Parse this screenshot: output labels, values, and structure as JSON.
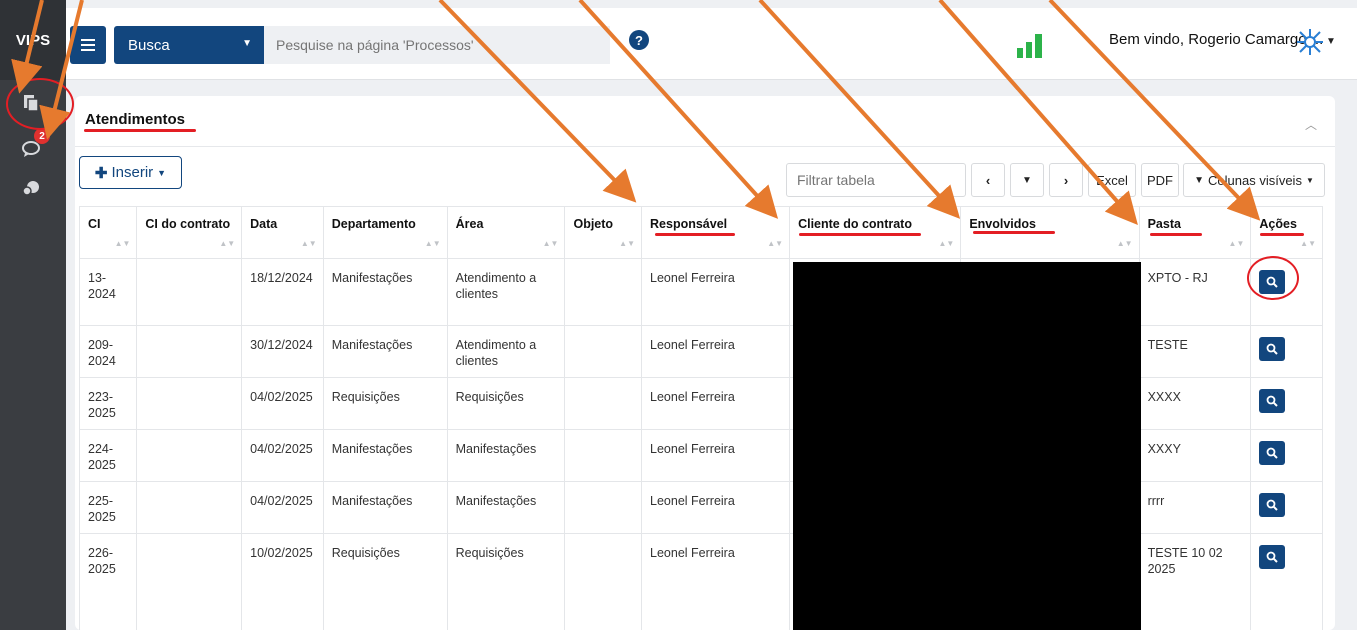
{
  "app": {
    "logo": "VIPS"
  },
  "sidebar": {
    "badge_count": "2",
    "icons": [
      "documents-icon",
      "chat-icon",
      "user-group-icon"
    ]
  },
  "topbar": {
    "search_select": "Busca",
    "search_placeholder": "Pesquise na página 'Processos'",
    "welcome": "Bem vindo, Rogerio Camargo ..."
  },
  "card": {
    "title": "Atendimentos",
    "insert_label": "Inserir",
    "filter_placeholder": "Filtrar tabela",
    "excel_label": "Excel",
    "pdf_label": "PDF",
    "columns_label": "Colunas visíveis"
  },
  "table": {
    "headers": [
      "CI",
      "CI do contrato",
      "Data",
      "Departamento",
      "Área",
      "Objeto",
      "Responsável",
      "Cliente do contrato",
      "Envolvidos",
      "Pasta",
      "Ações"
    ],
    "rows": [
      {
        "ci": "13-2024",
        "ci_contrato": "",
        "data": "18/12/2024",
        "departamento": "Manifestações",
        "area": "Atendimento a clientes",
        "objeto": "",
        "responsavel": "Leonel Ferreira",
        "cliente": "",
        "envolvidos": "",
        "pasta": "XPTO - RJ"
      },
      {
        "ci": "209-2024",
        "ci_contrato": "",
        "data": "30/12/2024",
        "departamento": "Manifestações",
        "area": "Atendimento a clientes",
        "objeto": "",
        "responsavel": "Leonel Ferreira",
        "cliente": "",
        "envolvidos": "",
        "pasta": "TESTE"
      },
      {
        "ci": "223-2025",
        "ci_contrato": "",
        "data": "04/02/2025",
        "departamento": "Requisições",
        "area": "Requisições",
        "objeto": "",
        "responsavel": "Leonel Ferreira",
        "cliente": "",
        "envolvidos": "",
        "pasta": "XXXX"
      },
      {
        "ci": "224-2025",
        "ci_contrato": "",
        "data": "04/02/2025",
        "departamento": "Manifestações",
        "area": "Manifestações",
        "objeto": "",
        "responsavel": "Leonel Ferreira",
        "cliente": "",
        "envolvidos": "",
        "pasta": "XXXY"
      },
      {
        "ci": "225-2025",
        "ci_contrato": "",
        "data": "04/02/2025",
        "departamento": "Manifestações",
        "area": "Manifestações",
        "objeto": "",
        "responsavel": "Leonel Ferreira",
        "cliente": "",
        "envolvidos": "",
        "pasta": "rrrr"
      },
      {
        "ci": "226-2025",
        "ci_contrato": "",
        "data": "10/02/2025",
        "departamento": "Requisições",
        "area": "Requisições",
        "objeto": "",
        "responsavel": "Leonel Ferreira",
        "cliente": "",
        "envolvidos": "",
        "pasta": "TESTE 10 02 2025"
      }
    ]
  },
  "colors": {
    "primary": "#12467e",
    "annotation": "#e31e24",
    "arrow": "#e67a2e"
  }
}
